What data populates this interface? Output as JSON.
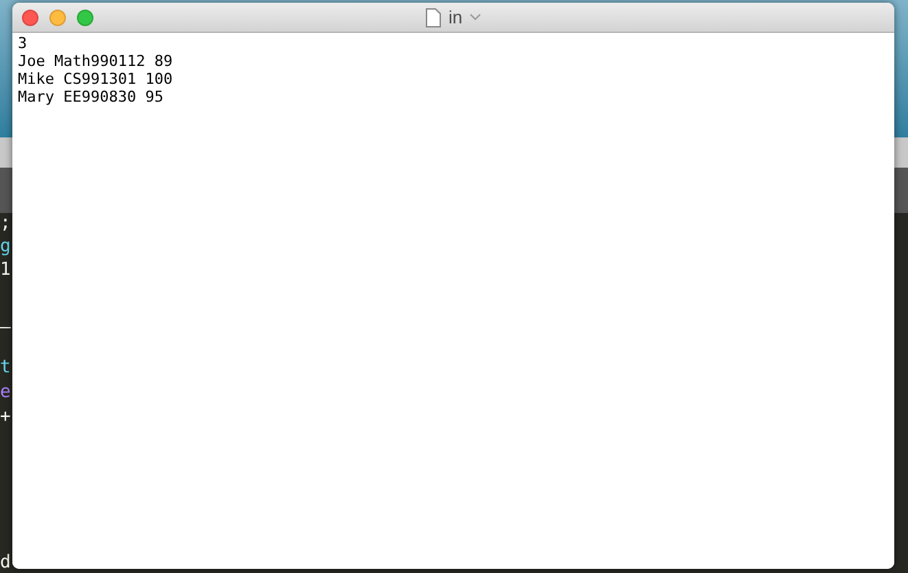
{
  "background_editor": {
    "fragments": [
      {
        "text": ";",
        "color": "#f8f8f2"
      },
      {
        "text": "g",
        "color": "#66d9ef"
      },
      {
        "text": "1",
        "color": "#f8f8f2"
      },
      {
        "text": "—",
        "color": "#f8f8f2"
      },
      {
        "text": "t",
        "color": "#66d9ef"
      },
      {
        "text": "e",
        "color": "#ae81ff"
      },
      {
        "text": "+",
        "color": "#f8f8f2"
      },
      {
        "text": "d",
        "color": "#f8f8f2"
      }
    ]
  },
  "window": {
    "title": "in"
  },
  "document": {
    "lines": [
      "3",
      "Joe Math990112 89",
      "Mike CS991301 100",
      "Mary EE990830 95"
    ]
  }
}
